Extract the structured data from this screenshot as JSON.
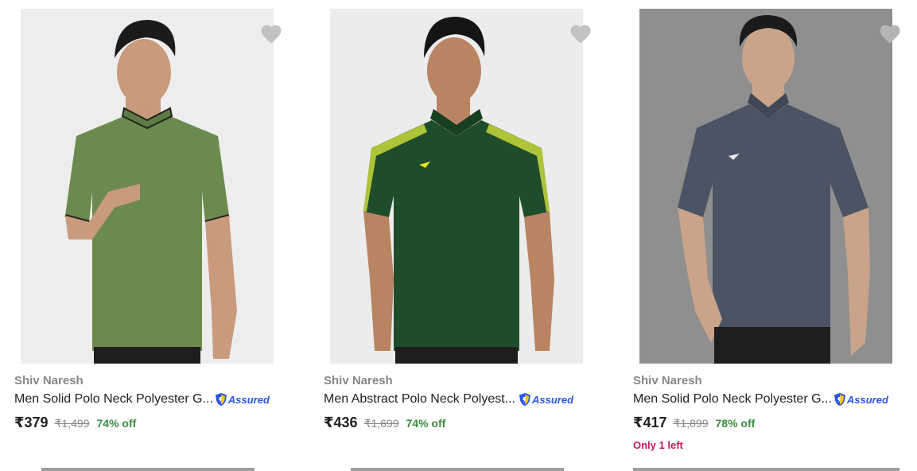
{
  "products": [
    {
      "brand": "Shiv Naresh",
      "title": "Men Solid Polo Neck Polyester G...",
      "assured": "Assured",
      "price": "₹379",
      "mrp": "₹1,499",
      "discount": "74% off",
      "stock": "",
      "shirt_color": "#6b8a4e",
      "bg_color": "#ededed",
      "wishlist_icon": "heart-icon"
    },
    {
      "brand": "Shiv Naresh",
      "title": "Men Abstract Polo Neck Polyest...",
      "assured": "Assured",
      "price": "₹436",
      "mrp": "₹1,699",
      "discount": "74% off",
      "stock": "",
      "shirt_color": "#1f4d2b",
      "bg_color": "#ececec",
      "wishlist_icon": "heart-icon"
    },
    {
      "brand": "Shiv Naresh",
      "title": "Men Solid Polo Neck Polyester G...",
      "assured": "Assured",
      "price": "₹417",
      "mrp": "₹1,899",
      "discount": "78% off",
      "stock": "Only 1 left",
      "shirt_color": "#4a5464",
      "bg_color": "#8f8f8f",
      "wishlist_icon": "heart-icon"
    }
  ],
  "colors": {
    "brand_text": "#878787",
    "price_text": "#212121",
    "discount": "#388e3c",
    "assured": "#2a55e5",
    "stock_alert": "#c2185b"
  }
}
